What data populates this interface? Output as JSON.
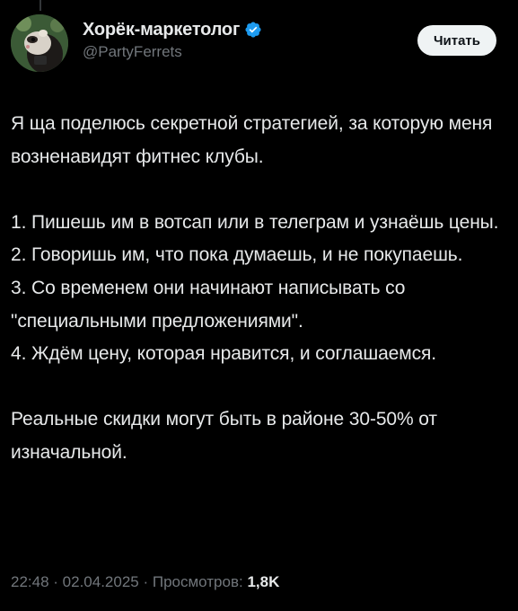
{
  "author": {
    "display_name": "Хорёк-маркетолог",
    "handle": "@PartyFerrets",
    "verified": true,
    "avatar_icon": "ferret-avatar-icon",
    "verified_color": "#1d9bf0"
  },
  "follow_button": {
    "label": "Читать"
  },
  "tweet": {
    "intro": "Я ща поделюсь секретной стратегией, за которую меня возненавидят фитнес клубы.",
    "steps": [
      "1. Пишешь им в вотсап или в телеграм и узнаёшь цены.",
      "2. Говоришь им, что пока думаешь, и не покупаешь.",
      "3. Со временем они начинают написывать со \"специальными предложениями\".",
      "4. Ждём цену, которая нравится, и соглашаемся."
    ],
    "conclusion": "Реальные скидки могут быть в районе 30-50% от изначальной."
  },
  "meta": {
    "time": "22:48",
    "separator": " · ",
    "date": "02.04.2025",
    "views_label": "Просмотров:",
    "views_count": "1,8K"
  },
  "colors": {
    "background": "#000000",
    "text": "#e7e9ea",
    "secondary_text": "#71767b",
    "button_bg": "#eff3f4"
  }
}
